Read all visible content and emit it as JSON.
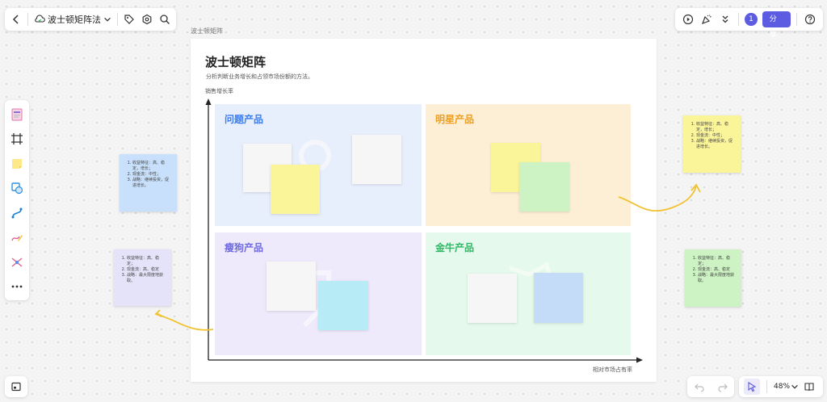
{
  "toolbar": {
    "doc_title": "波士顿矩阵法",
    "share_label": "分享",
    "collaborator_count": "1",
    "zoom": "48%"
  },
  "board": {
    "frame_label": "波士顿矩阵",
    "title": "波士顿矩阵",
    "subtitle": "分析判断业务增长和占领市场份额的方法。",
    "y_axis_label": "销售增长率",
    "x_axis_label": "相对市场占有率",
    "quadrants": [
      {
        "title": "问题产品",
        "color": "#3c7ef0"
      },
      {
        "title": "明星产品",
        "color": "#f0a020"
      },
      {
        "title": "瘦狗产品",
        "color": "#6f6ae0"
      },
      {
        "title": "金牛产品",
        "color": "#2fb865"
      }
    ]
  },
  "side_notes": {
    "blue": [
      "收益特征：高、稳定，增长；",
      "现金流：中性；",
      "战略：继续投资，促进增长。"
    ],
    "yellow": [
      "收益特征：高、稳定，增长；",
      "现金流：中性；",
      "战略：继续投资，促进增长。"
    ],
    "purple": [
      "收益特征：高、稳定；",
      "现金流：高、稳定",
      "战略：最大限度地获取。"
    ],
    "green": [
      "收益特征：高、稳定；",
      "现金流：高、稳定",
      "战略：最大限度地获取。"
    ]
  },
  "colors": {
    "accent": "#5b5ce2",
    "arrow": "#f2c230"
  }
}
